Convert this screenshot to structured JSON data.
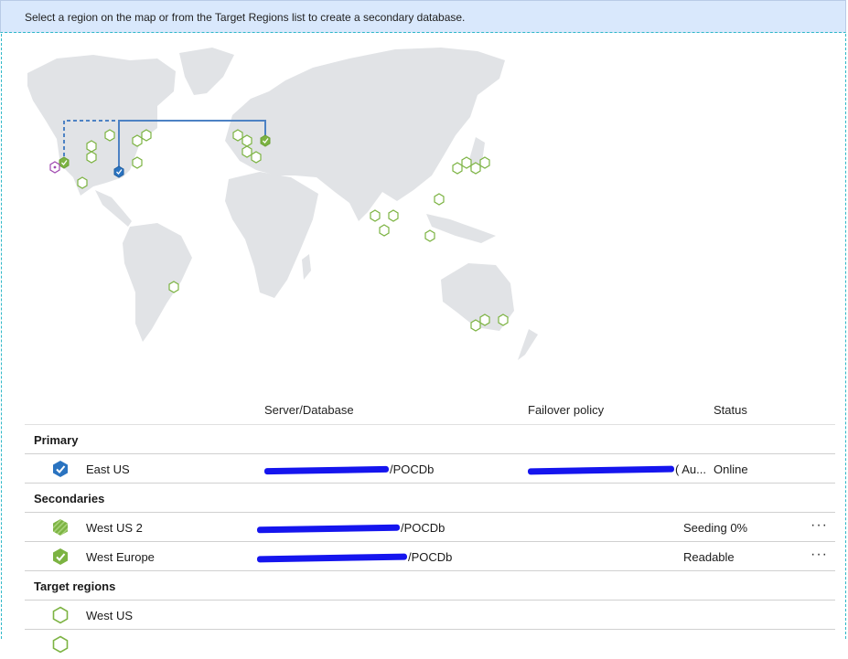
{
  "info_message": "Select a region on the map or from the Target Regions list to create a secondary database.",
  "columns": {
    "server": "Server/Database",
    "failover": "Failover policy",
    "status": "Status"
  },
  "sections": {
    "primary": "Primary",
    "secondaries": "Secondaries",
    "target": "Target regions"
  },
  "primary": {
    "region": "East US",
    "server_suffix": "/POCDb",
    "failover_suffix": "( Au...",
    "status": "Online"
  },
  "secondaries": [
    {
      "region": "West US 2",
      "server_suffix": "/POCDb",
      "status": "Seeding 0%",
      "more": "···"
    },
    {
      "region": "West Europe",
      "server_suffix": "/POCDb",
      "status": "Readable",
      "more": "···"
    }
  ],
  "targets": [
    {
      "region": "West US"
    }
  ],
  "colors": {
    "accent_green": "#7cb342",
    "primary_blue": "#2a73c0",
    "link_blue": "#4d82c4",
    "redaction": "#1515ee"
  }
}
